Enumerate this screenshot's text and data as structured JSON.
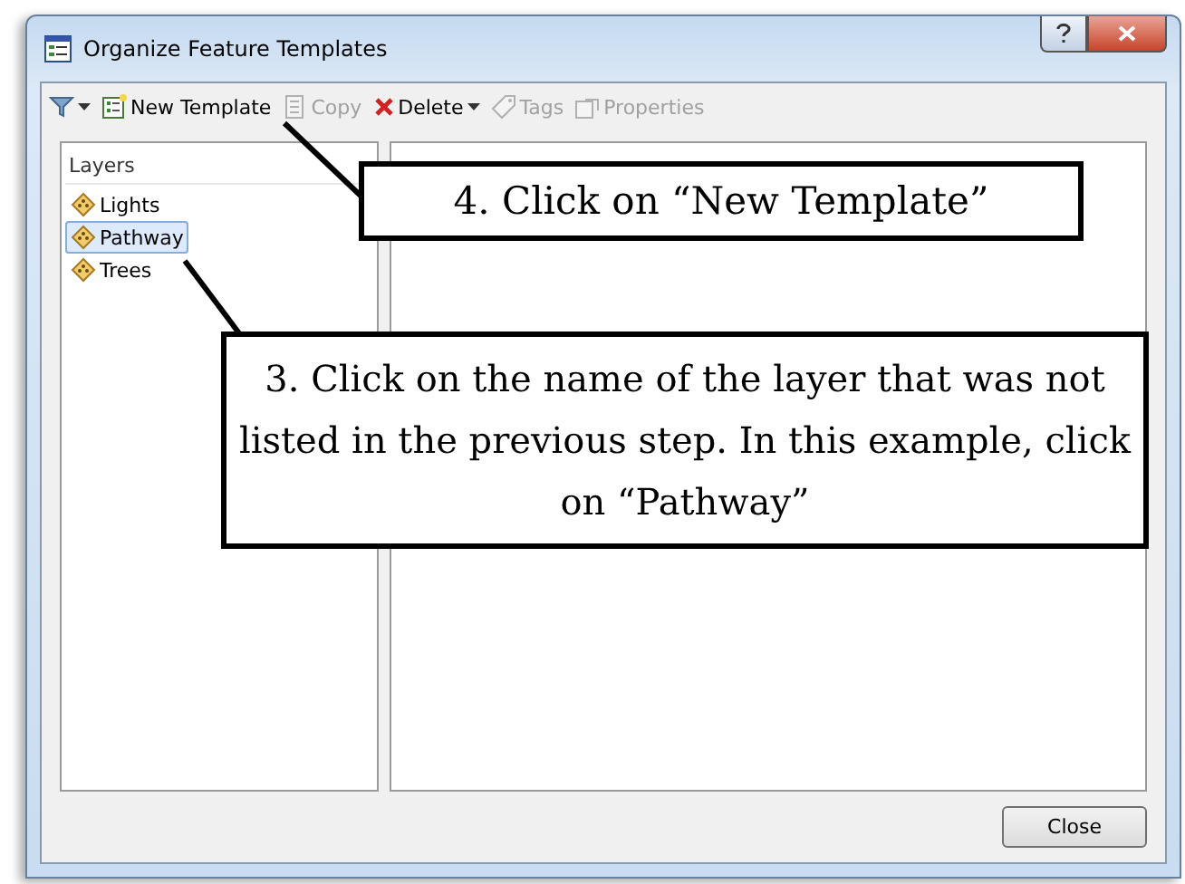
{
  "window": {
    "title": "Organize Feature Templates"
  },
  "toolbar": [
    {
      "kind": "filter",
      "has_dropdown": true
    },
    {
      "kind": "new",
      "label": "New Template",
      "disabled": false,
      "has_dropdown": false
    },
    {
      "kind": "copy",
      "label": "Copy",
      "disabled": true,
      "has_dropdown": false
    },
    {
      "kind": "delete",
      "label": "Delete",
      "disabled": false,
      "has_dropdown": true
    },
    {
      "kind": "tags",
      "label": "Tags",
      "disabled": true,
      "has_dropdown": false
    },
    {
      "kind": "properties",
      "label": "Properties",
      "disabled": true,
      "has_dropdown": false
    }
  ],
  "layers": {
    "header": "Layers",
    "items": [
      {
        "label": "Lights",
        "selected": false
      },
      {
        "label": "Pathway",
        "selected": true
      },
      {
        "label": "Trees",
        "selected": false
      }
    ]
  },
  "buttons": [
    {
      "label": "Close"
    }
  ],
  "callouts": [
    {
      "text": "4. Click on “New Template”"
    },
    {
      "text": "3. Click on the name of the layer that was not listed in the previous step. In this example, click on “Pathway”"
    }
  ]
}
